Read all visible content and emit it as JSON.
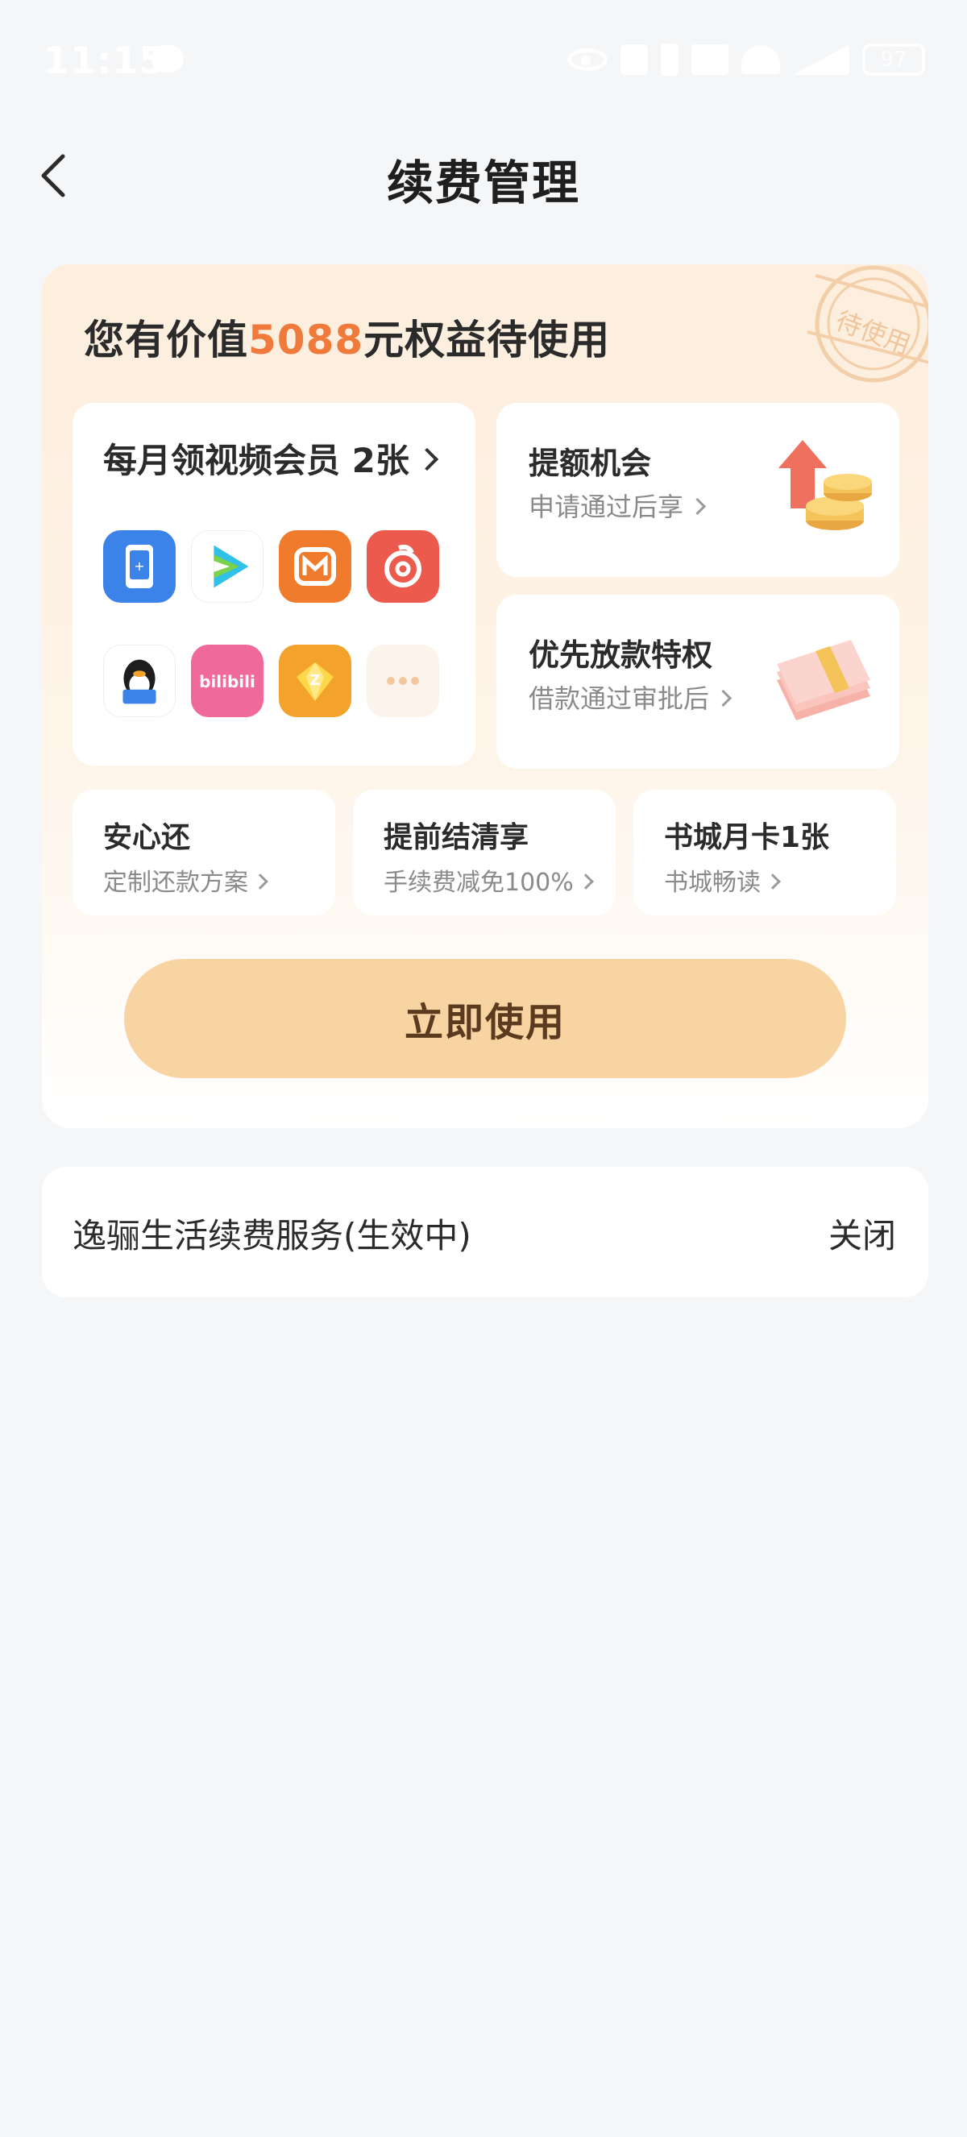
{
  "status_bar": {
    "time": "11:15",
    "battery": "97"
  },
  "header": {
    "title": "续费管理"
  },
  "benefit_card": {
    "headline_prefix": "您有价值",
    "headline_amount": "5088",
    "headline_suffix": "元权益待使用",
    "stamp_text": "待使用",
    "vip": {
      "title": "每月领视频会员 2张",
      "apps": [
        {
          "name": "tencent-video-icon",
          "color": "#3b82e9"
        },
        {
          "name": "iqiyi-video-icon",
          "color": "#ffffff"
        },
        {
          "name": "mgtv-icon",
          "color": "#f07b2d"
        },
        {
          "name": "netease-music-icon",
          "color": "#ec5a4d"
        },
        {
          "name": "qq-reader-icon",
          "color": "#ffffff"
        },
        {
          "name": "bilibili-icon",
          "color": "#ef6a9a"
        },
        {
          "name": "diamond-vip-icon",
          "color": "#f3a32b"
        },
        {
          "name": "more-icon",
          "color": "#fcf4ea"
        }
      ],
      "bilibili_text": "bilibili"
    },
    "quota": {
      "title": "提额机会",
      "subtitle": "申请通过后享"
    },
    "priority": {
      "title": "优先放款特权",
      "subtitle": "借款通过审批后"
    },
    "small_items": [
      {
        "title": "安心还",
        "subtitle": "定制还款方案"
      },
      {
        "title": "提前结清享",
        "subtitle": "手续费减免100%"
      },
      {
        "title": "书城月卡1张",
        "subtitle": "书城畅读"
      }
    ],
    "use_now_label": "立即使用"
  },
  "service": {
    "label": "逸骊生活续费服务(生效中)",
    "close_label": "关闭"
  }
}
